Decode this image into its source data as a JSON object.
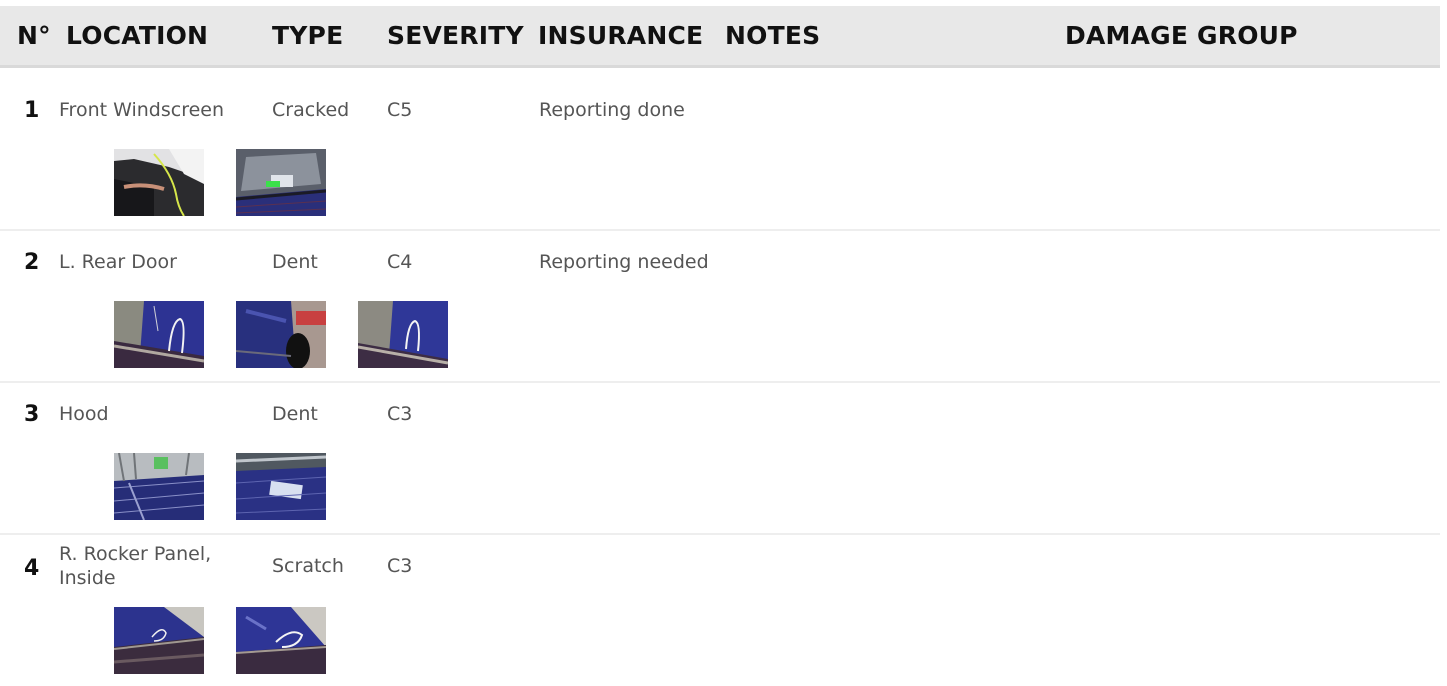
{
  "header": {
    "no": "N°",
    "location": "LOCATION",
    "type": "TYPE",
    "severity": "SEVERITY",
    "insurance": "INSURANCE",
    "notes": "NOTES",
    "damage_group": "DAMAGE GROUP"
  },
  "rows": [
    {
      "no": "1",
      "location": "Front Windscreen",
      "type": "Cracked",
      "severity": "C5",
      "insurance": "Reporting done",
      "notes": "",
      "damage_group": "",
      "photos": [
        "door-edge-photo",
        "windscreen-photo"
      ]
    },
    {
      "no": "2",
      "location": "L. Rear Door",
      "type": "Dent",
      "severity": "C4",
      "insurance": "Reporting needed",
      "notes": "",
      "damage_group": "",
      "photos": [
        "rear-door-marked-photo",
        "rear-door-side-photo",
        "rear-door-closeup-photo"
      ]
    },
    {
      "no": "3",
      "location": "Hood",
      "type": "Dent",
      "severity": "C3",
      "insurance": "",
      "notes": "",
      "damage_group": "",
      "photos": [
        "hood-garage-photo",
        "hood-reflection-photo"
      ]
    },
    {
      "no": "4",
      "location": "R. Rocker Panel, Inside",
      "type": "Scratch",
      "severity": "C3",
      "insurance": "",
      "notes": "",
      "damage_group": "",
      "photos": [
        "rocker-panel-photo",
        "rocker-panel-closeup-photo"
      ]
    }
  ],
  "colors": {
    "header_bg": "#e8e8e8",
    "header_text": "#111111",
    "cell_text": "#555555",
    "car_paint": "#2a2f8a"
  }
}
